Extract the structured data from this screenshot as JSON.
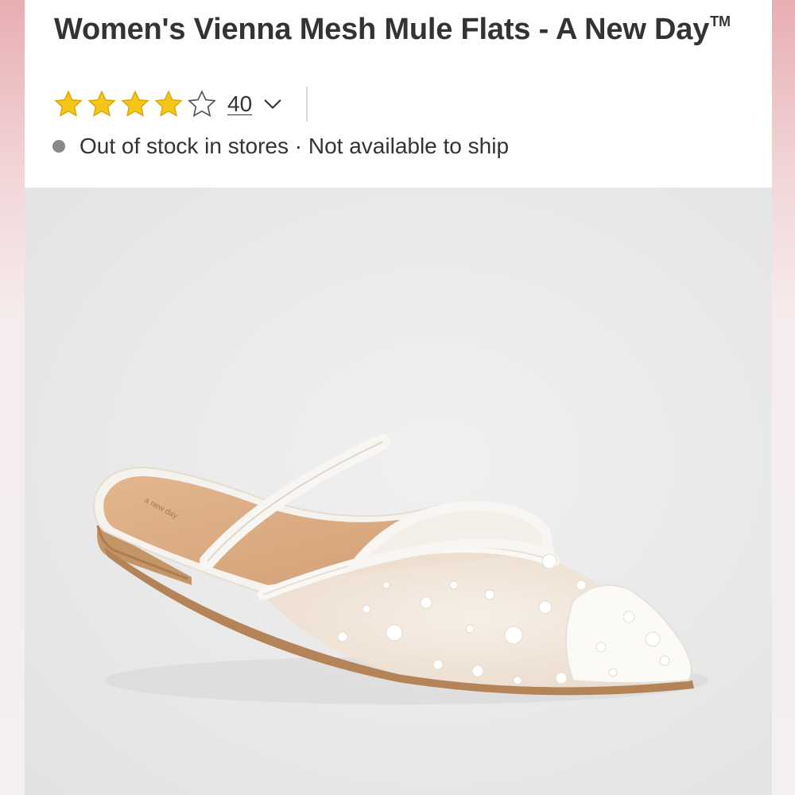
{
  "product": {
    "title": "Women's Vienna Mesh Mule Flats - A New Day",
    "trademark": "TM",
    "rating": {
      "value": 4,
      "max": 5,
      "review_count": "40"
    },
    "availability": "Out of stock in stores · Not available to ship",
    "image": {
      "brand_insole_mark": "a new day"
    }
  },
  "icons": {
    "star_filled": "star-filled-icon",
    "star_empty": "star-empty-icon",
    "chevron": "chevron-down-icon",
    "status": "status-dot-icon"
  },
  "colors": {
    "star": "#F5C518",
    "text": "#333333",
    "status_dot": "#888888",
    "edge_pink": "#E8AEB2"
  }
}
